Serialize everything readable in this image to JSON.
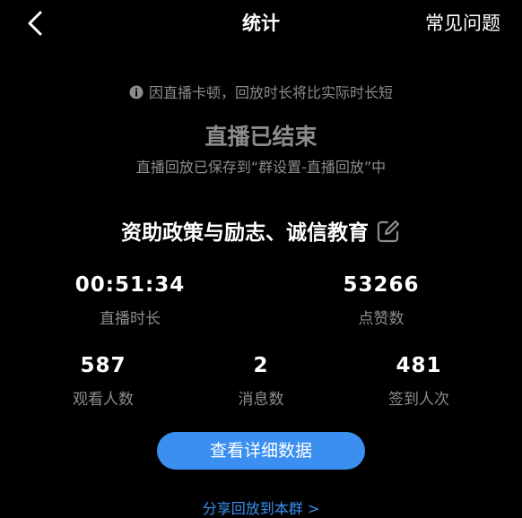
{
  "header": {
    "title": "统计",
    "faq_label": "常见问题",
    "back_icon": "chevron-left-icon"
  },
  "notice": {
    "icon": "info-icon",
    "text": "因直播卡顿，回放时长将比实际时长短"
  },
  "status": {
    "ended_text": "直播已结束",
    "saved_text": "直播回放已保存到“群设置-直播回放”中"
  },
  "live": {
    "title": "资助政策与励志、诚信教育",
    "edit_icon": "edit-icon"
  },
  "stats": {
    "duration": {
      "value": "00:51:34",
      "label": "直播时长"
    },
    "likes": {
      "value": "53266",
      "label": "点赞数"
    },
    "viewers": {
      "value": "587",
      "label": "观看人数"
    },
    "messages": {
      "value": "2",
      "label": "消息数"
    },
    "checkins": {
      "value": "481",
      "label": "签到人次"
    }
  },
  "actions": {
    "detail_button": "查看详细数据",
    "share_link": "分享回放到本群 >"
  },
  "colors": {
    "background": "#000000",
    "primary_text": "#ffffff",
    "secondary_text": "#8c8c8c",
    "accent": "#3a8ff0"
  }
}
